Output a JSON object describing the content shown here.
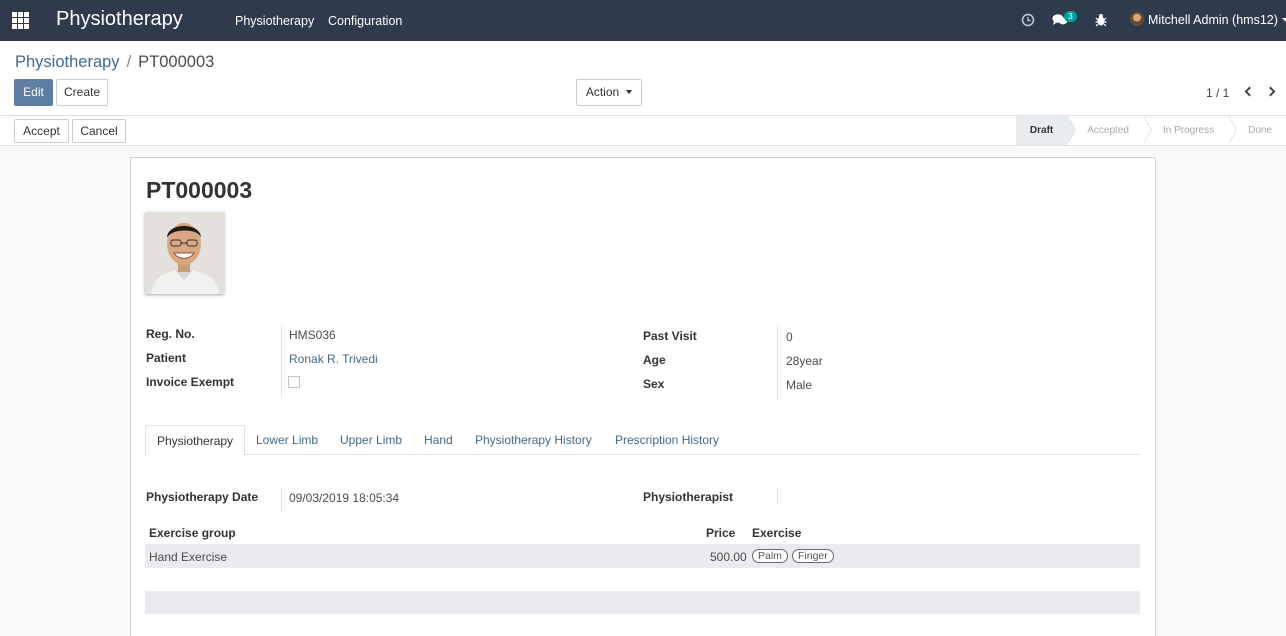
{
  "navbar": {
    "app_title": "Physiotherapy",
    "menus": [
      "Physiotherapy",
      "Configuration"
    ],
    "chat_count": "3",
    "user": "Mitchell Admin (hms12)",
    "icons": [
      "apps-grid-icon",
      "clock-icon",
      "chat-icon",
      "bug-icon"
    ]
  },
  "breadcrumb": {
    "parent": "Physiotherapy",
    "separator": "/",
    "current": "PT000003"
  },
  "buttons": {
    "edit": "Edit",
    "create": "Create",
    "action": "Action",
    "accept": "Accept",
    "cancel": "Cancel"
  },
  "pager": {
    "value": "1 / 1"
  },
  "status": {
    "steps": [
      "Draft",
      "Accepted",
      "In Progress",
      "Done"
    ],
    "active": "Draft"
  },
  "record": {
    "title": "PT000003",
    "left_fields": [
      {
        "label": "Reg. No.",
        "value": "HMS036"
      },
      {
        "label": "Patient",
        "value": "Ronak R. Trivedi"
      },
      {
        "label": "Invoice Exempt",
        "value": ""
      }
    ],
    "right_fields": [
      {
        "label": "Past Visit",
        "value": "0"
      },
      {
        "label": "Age",
        "value": "28year"
      },
      {
        "label": "Sex",
        "value": "Male"
      }
    ]
  },
  "tabs": [
    "Physiotherapy",
    "Lower Limb",
    "Upper Limb",
    "Hand",
    "Physiotherapy History",
    "Prescription History"
  ],
  "tab_content": {
    "date_label": "Physiotherapy Date",
    "date_value": "09/03/2019 18:05:34",
    "physiotherapist_label": "Physiotherapist",
    "physiotherapist_value": ""
  },
  "exercise_table": {
    "headers": [
      "Exercise group",
      "Price",
      "Exercise"
    ],
    "rows": [
      {
        "group": "Hand Exercise",
        "price": "500.00",
        "exercises": [
          "Palm",
          "Finger"
        ]
      }
    ]
  },
  "colors": {
    "navbar": "#2f3b4c",
    "primary": "#5e7ea4",
    "link": "#3f6b8c",
    "badge": "#00a09d"
  }
}
